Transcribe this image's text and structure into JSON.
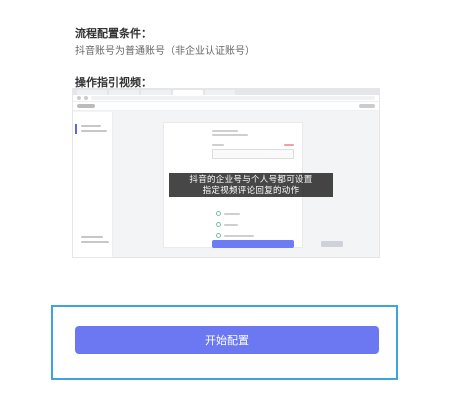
{
  "config": {
    "condition_title": "流程配置条件：",
    "condition_text": "抖音账号为普通账号（非企业认证账号）"
  },
  "guide": {
    "title": "操作指引视频：",
    "caption_line1": "抖音的企业号与个人号都可设置",
    "caption_line2": "指定视频评论回复的动作"
  },
  "action": {
    "start_label": "开始配置"
  },
  "colors": {
    "accent": "#6b78f2",
    "focus_border": "#3ea3e0"
  }
}
